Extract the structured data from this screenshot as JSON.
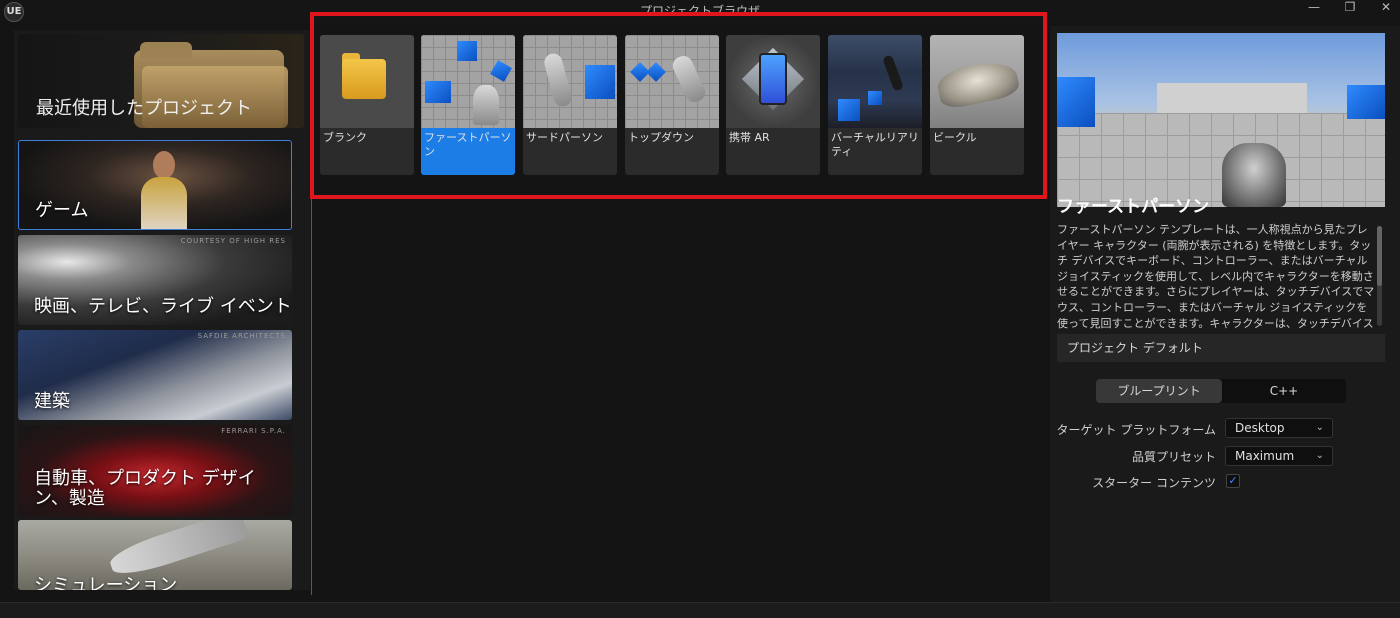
{
  "window": {
    "title": "プロジェクトブラウザ",
    "logo": "UE",
    "min_label": "—",
    "max_label": "❐",
    "close_label": "✕"
  },
  "left": {
    "recent": "最近使用したプロジェクト",
    "categories": [
      {
        "label": "ゲーム",
        "credit": ""
      },
      {
        "label": "映画、テレビ、ライブ イベント",
        "credit": "COURTESY OF HIGH RES"
      },
      {
        "label": "建築",
        "credit": "SAFDIE ARCHITECTS"
      },
      {
        "label": "自動車、プロダクト デザイン、製造",
        "credit": "FERRARI S.P.A."
      },
      {
        "label": "シミュレーション",
        "credit": ""
      }
    ]
  },
  "templates": [
    {
      "label": "ブランク",
      "selected": false
    },
    {
      "label": "ファーストパーソン",
      "selected": true
    },
    {
      "label": "サードパーソン",
      "selected": false
    },
    {
      "label": "トップダウン",
      "selected": false
    },
    {
      "label": "携帯 AR",
      "selected": false
    },
    {
      "label": "バーチャルリアリティ",
      "selected": false
    },
    {
      "label": "ビークル",
      "selected": false
    }
  ],
  "detail": {
    "title": "ファーストパーソン",
    "description": "ファーストパーソン テンプレートは、一人称視点から見たプレイヤー キャラクター (両腕が表示される) を特徴とします。タッチ デバイスでキーボード、コントローラー、またはバーチャル ジョイスティックを使用して、レベル内でキャラクターを移動させることができます。さらにプレイヤーは、タッチデバイスでマウス、コントローラー、またはバーチャル ジョイスティックを使って見回すことができます。キャラクターは、タッチデバイスで、マウス、コントローラー、またはバーチャル ジョイスティ",
    "section": "プロジェクト デフォルト",
    "seg_blueprint": "ブループリント",
    "seg_cpp": "C++",
    "platform_label": "ターゲット プラットフォーム",
    "platform_value": "Desktop",
    "quality_label": "品質プリセット",
    "quality_value": "Maximum",
    "starter_label": "スターター コンテンツ",
    "starter_checked": "✓",
    "caret": "⌄"
  },
  "colors": {
    "accent": "#1c7de6",
    "highlight": "#e1151c",
    "background": "#141414"
  }
}
